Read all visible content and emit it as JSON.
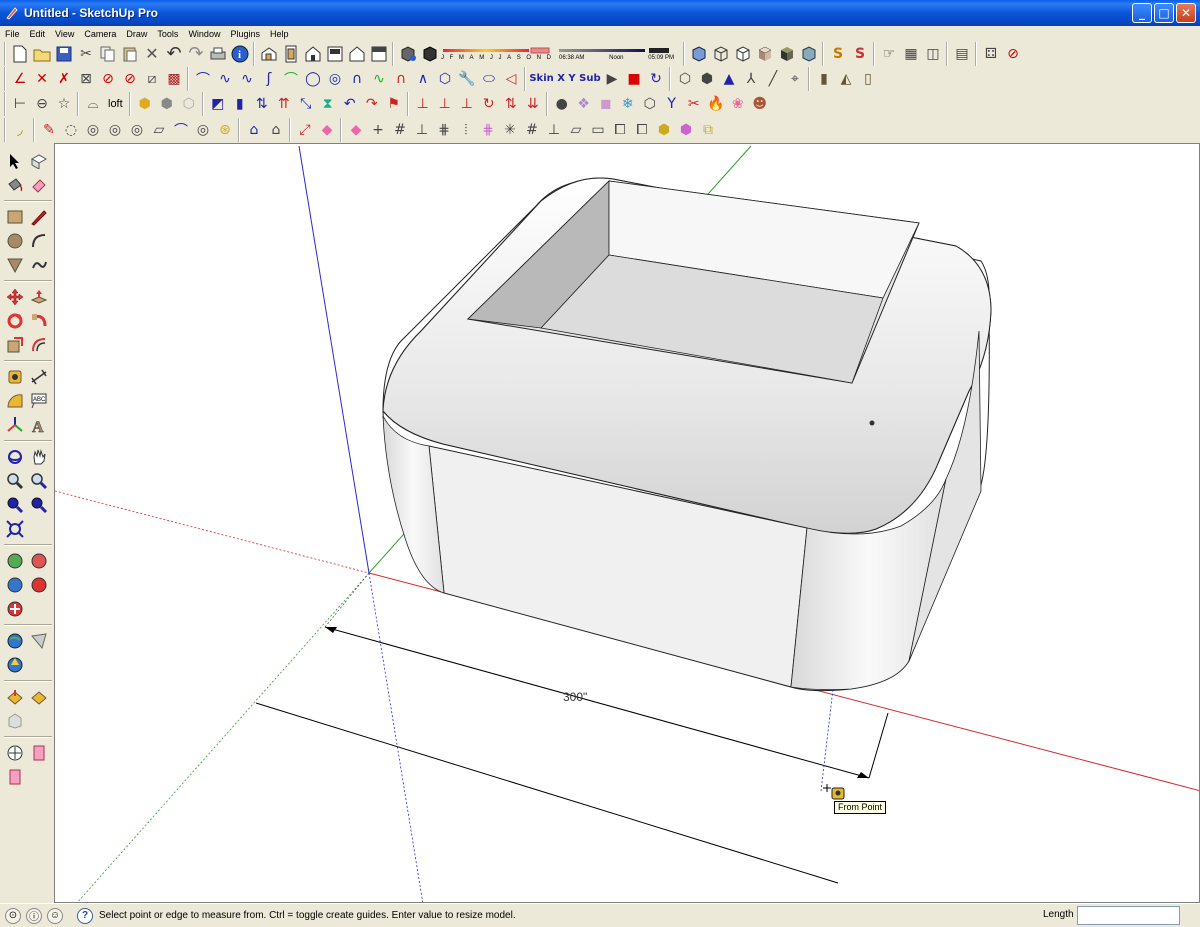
{
  "window": {
    "title": "Untitled - SketchUp Pro",
    "minimize": "_",
    "maximize": "□",
    "close": "✕"
  },
  "menu": [
    "File",
    "Edit",
    "View",
    "Camera",
    "Draw",
    "Tools",
    "Window",
    "Plugins",
    "Help"
  ],
  "toolbar": {
    "shadow_months": [
      "J",
      "F",
      "M",
      "A",
      "M",
      "J",
      "J",
      "A",
      "S",
      "O",
      "N",
      "D"
    ],
    "shadow_time_start": "06:38 AM",
    "shadow_time_mid": "Noon",
    "shadow_time_end": "05:09 PM",
    "loft_label": "loft",
    "skin_label": "Skin",
    "xy_label": "X Y",
    "sub_label": "Sub"
  },
  "viewport": {
    "dimension_label": "300\"",
    "tooltip": "From Point",
    "colors": {
      "red_axis": "#d22a2a",
      "green_axis": "#2aa12a",
      "blue_axis": "#2a2ad2"
    }
  },
  "status": {
    "message": "Select point or edge to measure from.  Ctrl = toggle create guides.  Enter value to resize model.",
    "length_label": "Length",
    "length_value": ""
  }
}
